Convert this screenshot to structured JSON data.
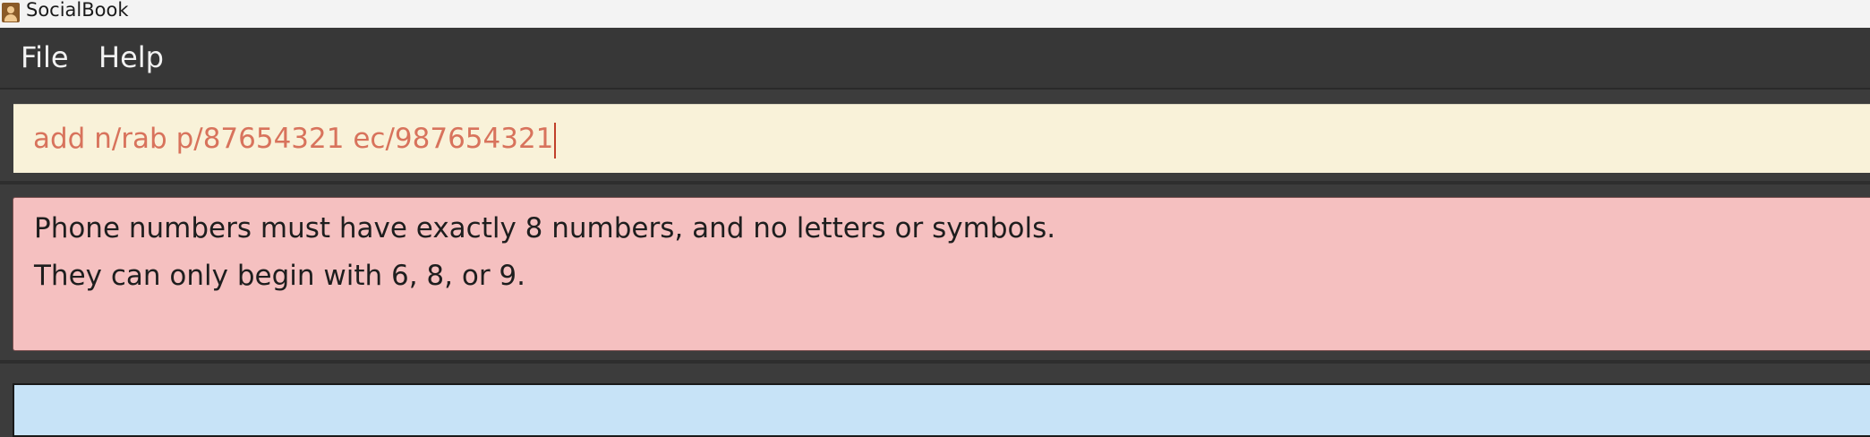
{
  "window": {
    "title": "SocialBook",
    "icon": "address-book-icon"
  },
  "menubar": {
    "items": [
      {
        "label": "File"
      },
      {
        "label": "Help"
      }
    ]
  },
  "command_box": {
    "value": "add n/rab p/87654321 ec/987654321"
  },
  "result_display": {
    "lines": [
      "Phone numbers must have exactly 8 numbers, and no letters or symbols.",
      "They can only begin with 6, 8, or 9."
    ]
  },
  "colors": {
    "command_bg": "#f9f2d9",
    "command_text": "#d8735c",
    "error_bg": "#f5c0c0",
    "list_bg": "#c7e3f7",
    "menubar_bg": "#373737"
  }
}
